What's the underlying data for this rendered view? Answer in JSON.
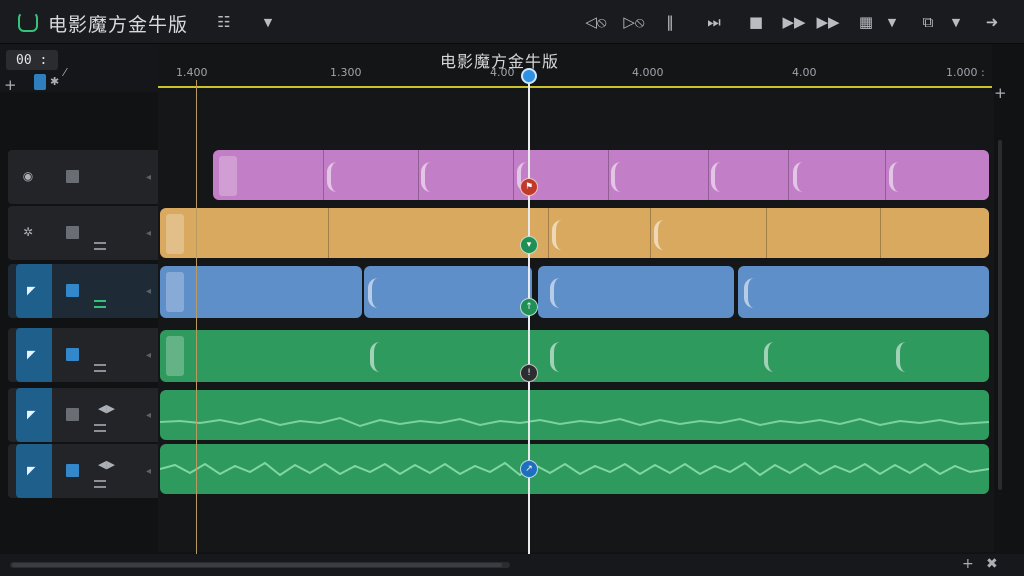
{
  "app": {
    "title": "电影魔方金牛版"
  },
  "toolbar": {
    "rewind_icon": "rewind-icon",
    "forward_icon": "fast-forward-icon",
    "pause_icon": "pause-icon",
    "skip_icon": "skip-end-icon",
    "stop_icon": "stop-icon",
    "play_icon": "play-icon",
    "next_icon": "next-icon",
    "grid_icon": "grid-icon",
    "layout_icon": "layout-icon",
    "export_icon": "export-icon"
  },
  "left_panel": {
    "timecode": "00 :"
  },
  "ruler": {
    "title": "电影魔方金牛版",
    "ticks": [
      "1.400",
      "1.300",
      "4.00",
      "4.000",
      "4.00",
      "1.000 :"
    ]
  },
  "tracks": [
    {
      "name": "video-track-1",
      "color": "#c27ec6"
    },
    {
      "name": "video-track-2",
      "color": "#d9a960"
    },
    {
      "name": "video-track-3",
      "color": "#5f8fc9"
    },
    {
      "name": "video-track-4",
      "color": "#2f9a5e"
    },
    {
      "name": "audio-track-1",
      "color": "#2f9a5e"
    },
    {
      "name": "audio-track-2",
      "color": "#2f9a5e"
    }
  ],
  "colors": {
    "accent": "#2f8fe0",
    "ruler": "#c9c22a",
    "playhead": "#e8eaed"
  }
}
